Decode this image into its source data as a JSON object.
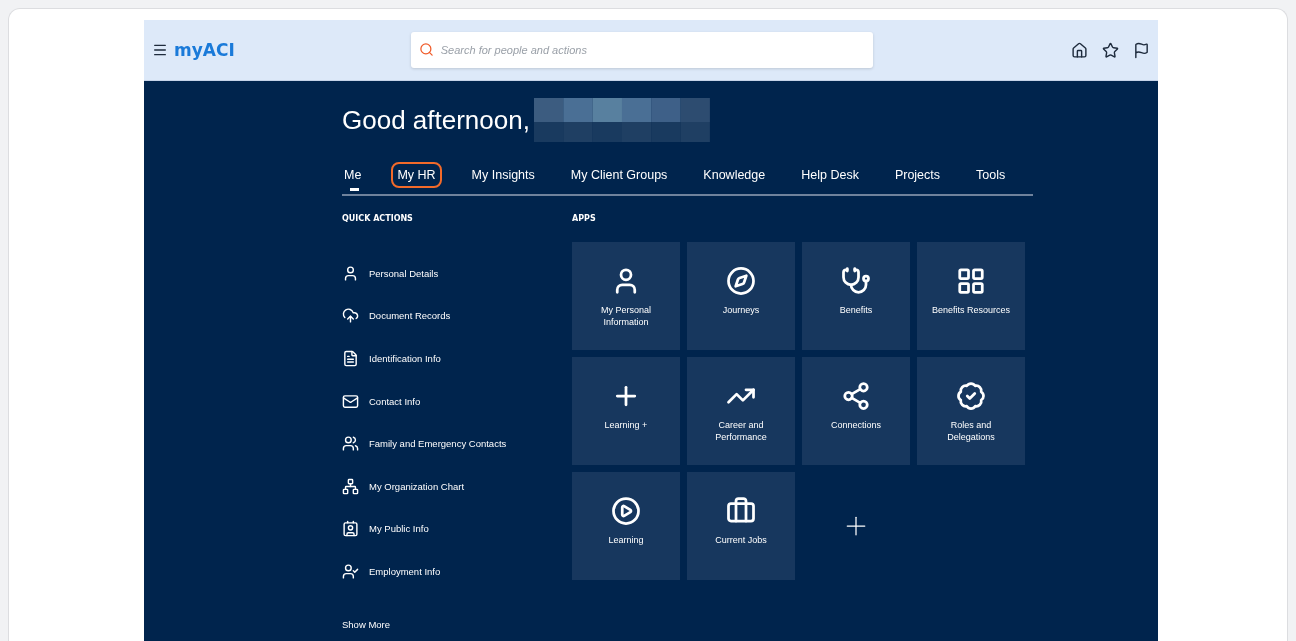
{
  "header": {
    "logo": "myACI",
    "search": {
      "placeholder": "Search for people and actions"
    }
  },
  "greeting": "Good afternoon,",
  "tabs": [
    {
      "label": "Me",
      "selected": true,
      "highlighted": false
    },
    {
      "label": "My HR",
      "selected": false,
      "highlighted": true
    },
    {
      "label": "My Insights",
      "selected": false,
      "highlighted": false
    },
    {
      "label": "My Client Groups",
      "selected": false,
      "highlighted": false
    },
    {
      "label": "Knowledge",
      "selected": false,
      "highlighted": false
    },
    {
      "label": "Help Desk",
      "selected": false,
      "highlighted": false
    },
    {
      "label": "Projects",
      "selected": false,
      "highlighted": false
    },
    {
      "label": "Tools",
      "selected": false,
      "highlighted": false
    }
  ],
  "quick_actions": {
    "heading": "QUICK ACTIONS",
    "items": [
      "Personal Details",
      "Document Records",
      "Identification Info",
      "Contact Info",
      "Family and Emergency Contacts",
      "My Organization Chart",
      "My Public Info",
      "Employment Info"
    ],
    "show_more": "Show More"
  },
  "apps": {
    "heading": "APPS",
    "tiles": [
      {
        "kind": "app",
        "label": "My Personal Information"
      },
      {
        "kind": "app",
        "label": "Journeys"
      },
      {
        "kind": "app",
        "label": "Benefits"
      },
      {
        "kind": "app",
        "label": "Benefits Resources"
      },
      {
        "kind": "app",
        "label": "Learning +"
      },
      {
        "kind": "app",
        "label": "Career and Performance"
      },
      {
        "kind": "app",
        "label": "Connections"
      },
      {
        "kind": "app",
        "label": "Roles and Delegations"
      },
      {
        "kind": "app",
        "label": "Learning"
      },
      {
        "kind": "app",
        "label": "Current Jobs"
      },
      {
        "kind": "add"
      }
    ]
  }
}
